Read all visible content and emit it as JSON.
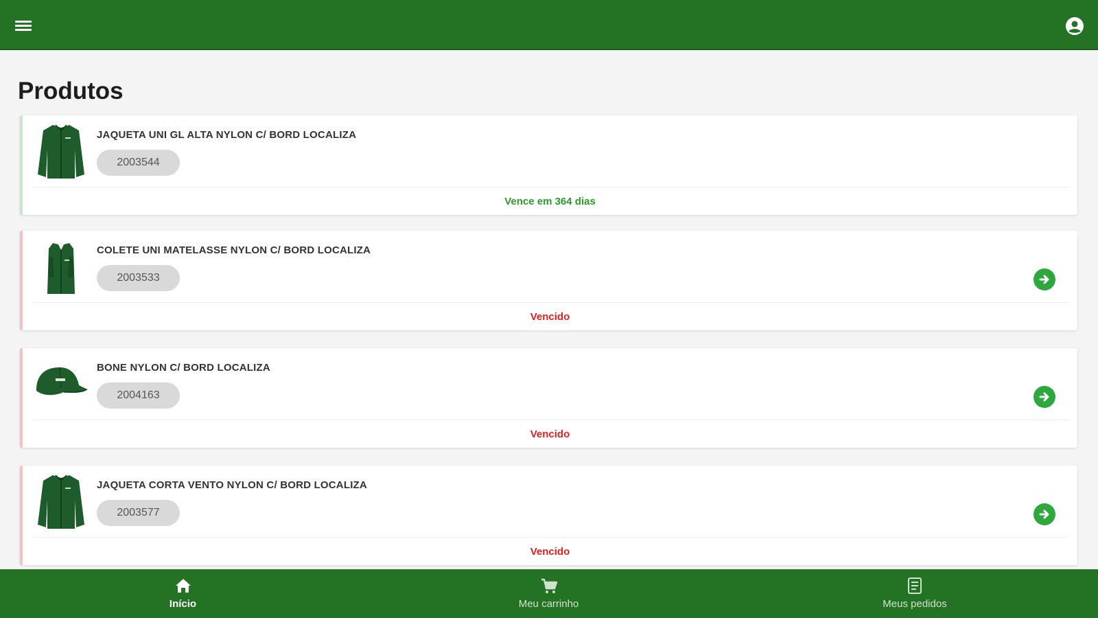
{
  "header": {
    "menu_icon": "menu-icon",
    "account_icon": "account-circle-icon"
  },
  "page": {
    "title": "Produtos"
  },
  "products": [
    {
      "name": "JAQUETA UNI GL ALTA NYLON C/ BORD LOCALIZA",
      "code": "2003544",
      "status": "Vence em 364 dias",
      "status_type": "ok",
      "image": "jacket-icon",
      "has_action": false
    },
    {
      "name": "COLETE UNI MATELASSE NYLON C/ BORD LOCALIZA",
      "code": "2003533",
      "status": "Vencido",
      "status_type": "expired",
      "image": "vest-icon",
      "has_action": true
    },
    {
      "name": "BONE NYLON C/ BORD LOCALIZA",
      "code": "2004163",
      "status": "Vencido",
      "status_type": "expired",
      "image": "cap-icon",
      "has_action": true
    },
    {
      "name": "JAQUETA CORTA VENTO NYLON C/ BORD LOCALIZA",
      "code": "2003577",
      "status": "Vencido",
      "status_type": "expired",
      "image": "jacket-icon",
      "has_action": true
    }
  ],
  "bottom_nav": [
    {
      "label": "Início",
      "icon": "home-icon",
      "active": true
    },
    {
      "label": "Meu carrinho",
      "icon": "cart-icon",
      "active": false
    },
    {
      "label": "Meus pedidos",
      "icon": "receipt-icon",
      "active": false
    }
  ],
  "colors": {
    "primary": "#247223",
    "ok_text": "#2a9a2a",
    "expired_text": "#e01f1f",
    "action_button": "#2ea73c",
    "chip_bg": "#d9d9d9"
  }
}
